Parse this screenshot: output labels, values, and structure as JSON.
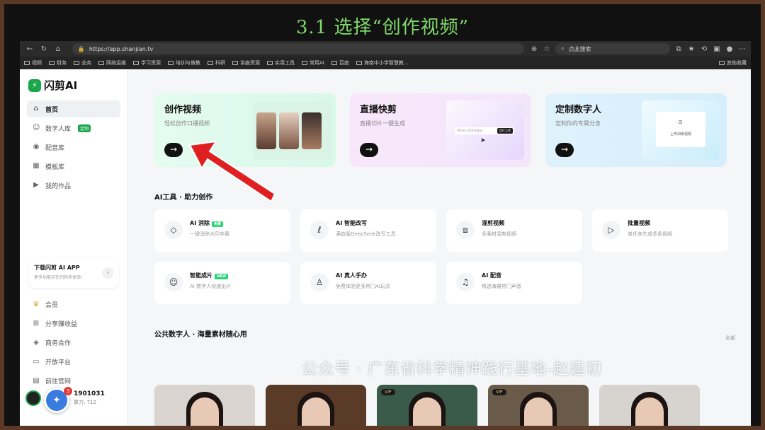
{
  "slide": {
    "title": "3.1 选择“创作视频”"
  },
  "browser": {
    "url": "https://app.shanjian.tv",
    "search_placeholder": "点此搜索",
    "bookmarks": [
      "视频",
      "财务",
      "业务",
      "网络运维",
      "学习资源",
      "培训与做教",
      "科研",
      "讲座资源",
      "实用工具",
      "常用AI",
      "百度",
      "海南中小学智慧教..."
    ],
    "bookmarks_right": "其他收藏"
  },
  "sidebar": {
    "logo": "闪剪AI",
    "nav": [
      {
        "label": "首页",
        "icon": "home-icon"
      },
      {
        "label": "数字人库",
        "icon": "person-icon",
        "badge": "定制"
      },
      {
        "label": "配音库",
        "icon": "audio-icon"
      },
      {
        "label": "模板库",
        "icon": "template-icon"
      },
      {
        "label": "我的作品",
        "icon": "play-icon"
      }
    ],
    "app_card": {
      "title": "下载闪剪 AI APP",
      "sub": "更多功能尽在扫码来体验!"
    },
    "nav2": [
      {
        "label": "会员",
        "icon": "vip-icon"
      },
      {
        "label": "分享赚收益",
        "icon": "gift-icon"
      },
      {
        "label": "商务合作",
        "icon": "handshake-icon"
      },
      {
        "label": "开放平台",
        "icon": "platform-icon"
      },
      {
        "label": "前往官网",
        "icon": "website-icon"
      }
    ],
    "user": {
      "name": "1901031",
      "points": "算力: 712"
    },
    "float_badge": "3"
  },
  "hero": [
    {
      "title": "创作视频",
      "sub": "轻松创作口播视频"
    },
    {
      "title": "直播快剪",
      "sub": "直播切片一键生成",
      "mock_input": "https://shanjia...",
      "mock_btn": "切片上传"
    },
    {
      "title": "定制数字人",
      "sub": "定制你的专属分身",
      "mock_box": "上传训练视频"
    }
  ],
  "ai_tools": {
    "title": "AI工具 · 助力创作",
    "items": [
      {
        "title": "AI 消除",
        "desc": "一键消除水印字幕",
        "tag": "免费",
        "icon": "eraser-icon"
      },
      {
        "title": "AI 智能改写",
        "desc": "满血版DeepSeek改写工具",
        "icon": "rewrite-icon"
      },
      {
        "title": "混剪视频",
        "desc": "多素材混剪视频",
        "icon": "mix-video-icon"
      },
      {
        "title": "批量视频",
        "desc": "单任务生成多条视频",
        "icon": "batch-video-icon"
      },
      {
        "title": "智能成片",
        "desc": "AI 数字人快速出片",
        "tag": "NEW",
        "icon": "smart-film-icon"
      },
      {
        "title": "AI 真人手办",
        "desc": "免费体验更多热门AI玩法",
        "icon": "figure-icon"
      },
      {
        "title": "AI 配音",
        "desc": "精选海量热门声音",
        "icon": "voice-icon"
      }
    ]
  },
  "digital_humans": {
    "title": "公共数字人 · 海量素材随心用",
    "see_all": "全部",
    "vip_label": "VIP"
  },
  "watermark": "公众号 · 广东省科学精神践行基地-赵建初",
  "colors": {
    "accent_green": "#1aa64a",
    "slide_title": "#7fd96a",
    "arrow": "#e02020"
  }
}
